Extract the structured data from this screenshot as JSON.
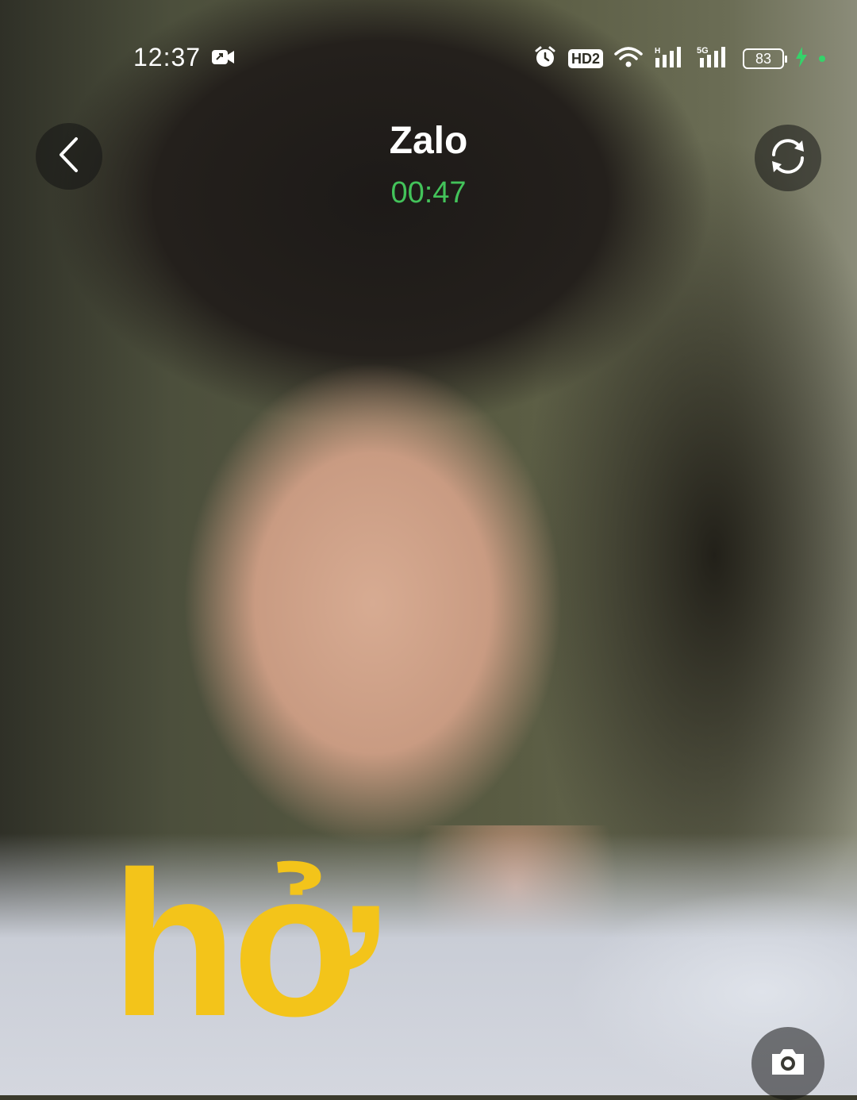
{
  "status_bar": {
    "time": "12:37",
    "battery": "83",
    "network": "5G",
    "hd_label": "HD2"
  },
  "call": {
    "app_title": "Zalo",
    "duration": "00:47"
  },
  "overlay": {
    "caption": "hở"
  },
  "icons": {
    "back": "back-arrow-icon",
    "switch_camera": "switch-camera-icon",
    "camera": "camera-icon",
    "screen_record": "screen-record-icon",
    "alarm": "alarm-icon",
    "wifi": "wifi-icon",
    "signal": "signal-icon",
    "charging": "charging-icon"
  },
  "colors": {
    "timer": "#43c35a",
    "caption": "#f3c41a",
    "charging": "#35d36a"
  }
}
